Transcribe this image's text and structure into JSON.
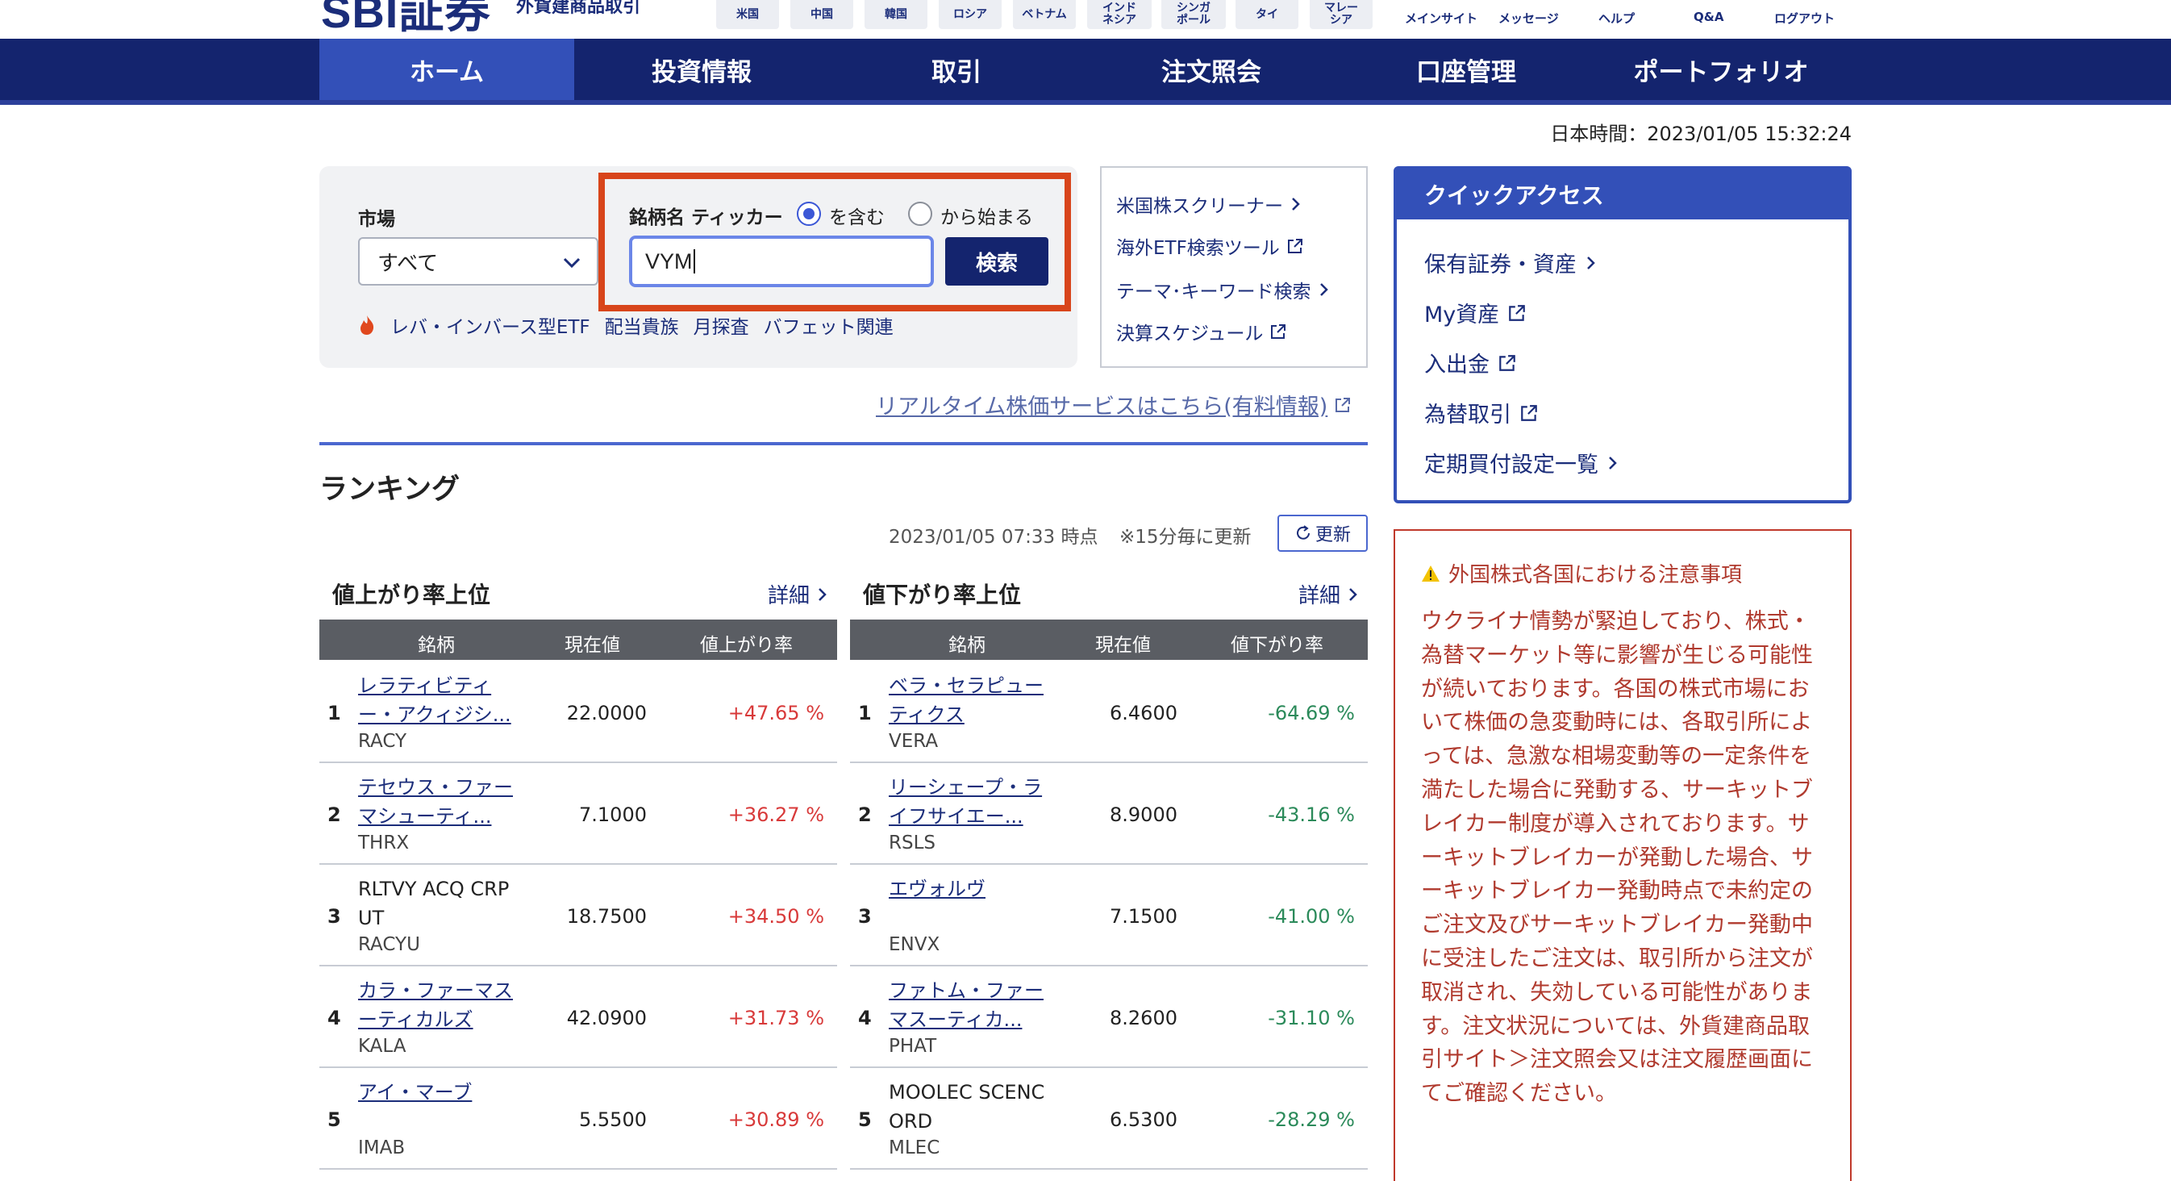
{
  "brand": {
    "logo": "SBI証券",
    "subtitle": "外貨建商品取引"
  },
  "countries": [
    "米国",
    "中国",
    "韓国",
    "ロシア",
    "ベトナム",
    "インドネシア",
    "シンガポール",
    "タイ",
    "マレーシア"
  ],
  "utility_links": [
    "メインサイト",
    "メッセージ",
    "ヘルプ",
    "Q&A",
    "ログアウト"
  ],
  "nav": {
    "items": [
      "ホーム",
      "投資情報",
      "取引",
      "注文照会",
      "口座管理",
      "ポートフォリオ"
    ],
    "active": "ホーム"
  },
  "clock": "日本時間：2023/01/05 15:32:24",
  "search": {
    "market_label": "市場",
    "market_value": "すべて",
    "ticker_label": "銘柄名 ティッカー",
    "option_contains": "を含む",
    "option_starts": "から始まる",
    "selected_option": "を含む",
    "query": "VYM",
    "button": "検索",
    "quick_tags": [
      "レバ・インバース型ETF",
      "配当貴族",
      "月探査",
      "バフェット関連"
    ]
  },
  "tools": [
    "米国株スクリーナー",
    "海外ETF検索ツール",
    "テーマ･キーワード検索",
    "決算スケジュール"
  ],
  "realtime_link": "リアルタイム株価サービスはこちら(有料情報)",
  "ranking": {
    "title": "ランキング",
    "timestamp": "2023/01/05 07:33 時点",
    "note": "※15分毎に更新",
    "refresh": "更新",
    "more": "詳細",
    "gainers": {
      "title": "値上がり率上位",
      "columns": [
        "銘柄",
        "現在値",
        "値上がり率"
      ],
      "rows": [
        {
          "rank": "1",
          "name": "レラティビティ ー・アクィジシ...",
          "ticker": "RACY",
          "price": "22.0000",
          "change": "+47.65 %",
          "link": true
        },
        {
          "rank": "2",
          "name": "テセウス・ファー マシューティ...",
          "ticker": "THRX",
          "price": "7.1000",
          "change": "+36.27 %",
          "link": true
        },
        {
          "rank": "3",
          "name": "RLTVY ACQ CRP UT",
          "ticker": "RACYU",
          "price": "18.7500",
          "change": "+34.50 %",
          "link": false
        },
        {
          "rank": "4",
          "name": "カラ・ファーマス ーティカルズ",
          "ticker": "KALA",
          "price": "42.0900",
          "change": "+31.73 %",
          "link": true
        },
        {
          "rank": "5",
          "name": "アイ・マーブ",
          "ticker": "IMAB",
          "price": "5.5500",
          "change": "+30.89 %",
          "link": true
        }
      ]
    },
    "losers": {
      "title": "値下がり率上位",
      "columns": [
        "銘柄",
        "現在値",
        "値下がり率"
      ],
      "rows": [
        {
          "rank": "1",
          "name": "ベラ・セラピュー ティクス",
          "ticker": "VERA",
          "price": "6.4600",
          "change": "-64.69 %",
          "link": true
        },
        {
          "rank": "2",
          "name": "リーシェープ・ラ イフサイエー...",
          "ticker": "RSLS",
          "price": "8.9000",
          "change": "-43.16 %",
          "link": true
        },
        {
          "rank": "3",
          "name": "エヴォルヴ",
          "ticker": "ENVX",
          "price": "7.1500",
          "change": "-41.00 %",
          "link": true
        },
        {
          "rank": "4",
          "name": "ファトム・ファー マスーティカ...",
          "ticker": "PHAT",
          "price": "8.2600",
          "change": "-31.10 %",
          "link": true
        },
        {
          "rank": "5",
          "name": "MOOLEC SCENC ORD",
          "ticker": "MLEC",
          "price": "6.5300",
          "change": "-28.29 %",
          "link": false
        }
      ]
    }
  },
  "quick_access": {
    "title": "クイックアクセス",
    "items": [
      {
        "label": "保有証券・資産",
        "icon": "chevron-right-icon"
      },
      {
        "label": "My資産",
        "icon": "external-link-icon"
      },
      {
        "label": "入出金",
        "icon": "external-link-icon"
      },
      {
        "label": "為替取引",
        "icon": "external-link-icon"
      },
      {
        "label": "定期買付設定一覧",
        "icon": "chevron-right-icon"
      }
    ]
  },
  "notice": {
    "title": "外国株式各国における注意事項",
    "body": "ウクライナ情勢が緊迫しており、株式・為替マーケット等に影響が生じる可能性が続いております。各国の株式市場において株価の急変動時には、各取引所によっては、急激な相場変動等の一定条件を満たした場合に発動する、サーキットブレイカー制度が導入されております。サーキットブレイカーが発動した場合、サーキットブレイカー発動時点で未約定のご注文及びサーキットブレイカー発動中に受注したご注文は、取引所から注文が取消され、失効している可能性があります。注文状況については、外貨建商品取引サイト＞注文照会又は注文履歴画面にてご確認ください。"
  },
  "colors": {
    "brand_navy": "#14246e",
    "nav_active": "#3350b8",
    "highlight": "#d8451b",
    "gain": "#d83a3a",
    "loss": "#2b8a5a",
    "notice": "#b03a2e"
  }
}
